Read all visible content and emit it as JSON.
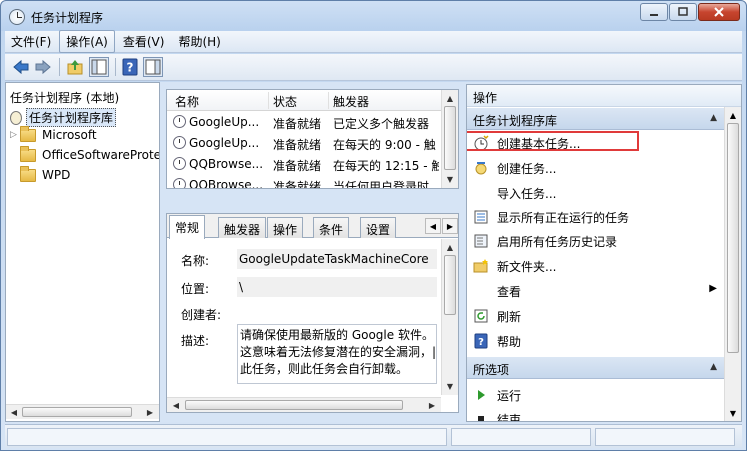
{
  "window": {
    "title": "任务计划程序"
  },
  "menubar": {
    "items": [
      {
        "label": "文件(F)"
      },
      {
        "label": "操作(A)"
      },
      {
        "label": "查看(V)"
      },
      {
        "label": "帮助(H)"
      }
    ]
  },
  "toolbar": {
    "buttons": [
      "back-arrow-icon",
      "forward-arrow-icon",
      "up-folder-icon",
      "show-hide-tree-icon",
      "help-icon",
      "show-hide-action-pane-icon"
    ]
  },
  "tree": {
    "root": "任务计划程序 (本地)",
    "library": "任务计划程序库",
    "children": [
      "Microsoft",
      "OfficeSoftwareProte",
      "WPD"
    ]
  },
  "tasklist": {
    "columns": [
      "名称",
      "状态",
      "触发器"
    ],
    "rows": [
      {
        "name": "GoogleUp...",
        "status": "准备就绪",
        "trigger": "已定义多个触发器"
      },
      {
        "name": "GoogleUp...",
        "status": "准备就绪",
        "trigger": "在每天的 9:00 - 触"
      },
      {
        "name": "QQBrowse...",
        "status": "准备就绪",
        "trigger": "在每天的 12:15 - 触"
      },
      {
        "name": "QQBrowse...",
        "status": "准备就绪",
        "trigger": "当任何用户登录时"
      }
    ]
  },
  "details": {
    "tabs": [
      "常规",
      "触发器",
      "操作",
      "条件",
      "设置"
    ],
    "name_label": "名称:",
    "name_value": "GoogleUpdateTaskMachineCore",
    "location_label": "位置:",
    "location_value": "\\",
    "author_label": "创建者:",
    "description_label": "描述:",
    "description_lines": [
      "请确保使用最新版的 Google 软件。",
      "这意味着无法修复潜在的安全漏洞，|",
      "此任务，则此任务会自行卸载。"
    ]
  },
  "actions": {
    "title": "操作",
    "section1": "任务计划程序库",
    "items": [
      {
        "label": "创建基本任务...",
        "icon": "create-basic-task-icon"
      },
      {
        "label": "创建任务...",
        "icon": "create-task-icon"
      },
      {
        "label": "导入任务...",
        "icon": ""
      },
      {
        "label": "显示所有正在运行的任务",
        "icon": "running-tasks-icon"
      },
      {
        "label": "启用所有任务历史记录",
        "icon": "history-icon"
      },
      {
        "label": "新文件夹...",
        "icon": "new-folder-icon"
      },
      {
        "label": "查看",
        "icon": ""
      },
      {
        "label": "刷新",
        "icon": "refresh-icon"
      },
      {
        "label": "帮助",
        "icon": "help-icon"
      }
    ],
    "section2": "所选项",
    "items2": [
      {
        "label": "运行",
        "icon": "run-icon"
      },
      {
        "label": "结束",
        "icon": "end-icon"
      }
    ]
  }
}
